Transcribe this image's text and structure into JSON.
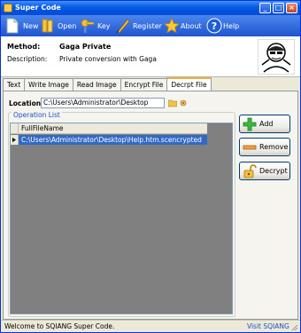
{
  "window": {
    "title": "Super Code"
  },
  "toolbar": {
    "new": "New",
    "open": "Open",
    "key": "Key",
    "register": "Register",
    "about": "About",
    "help": "Help"
  },
  "info": {
    "method_label": "Method:",
    "method_value": "Gaga Private",
    "description_label": "Description:",
    "description_value": "Private conversion with Gaga"
  },
  "tabs": [
    "Text",
    "Write Image",
    "Read Image",
    "Encrypt File",
    "Decrpt File"
  ],
  "location": {
    "label": "Location:",
    "value": "C:\\Users\\Administrator\\Desktop"
  },
  "operation_list": {
    "title": "Operation List",
    "column": "FullFileName",
    "rows": [
      "C:\\Users\\Administrator\\Desktop\\Help.htm.scencrypted"
    ]
  },
  "buttons": {
    "add": "Add",
    "remove": "Remove",
    "decrypt": "Decrypt"
  },
  "status": {
    "left": "Welcome to SQIANG Super Code.",
    "link": "Visit SQIANG"
  },
  "colors": {
    "title_bar": "#0a5be0",
    "toolbar": "#2b63d8",
    "selection": "#316ac5",
    "grid_bg": "#808080",
    "link": "#1c4fc9"
  }
}
